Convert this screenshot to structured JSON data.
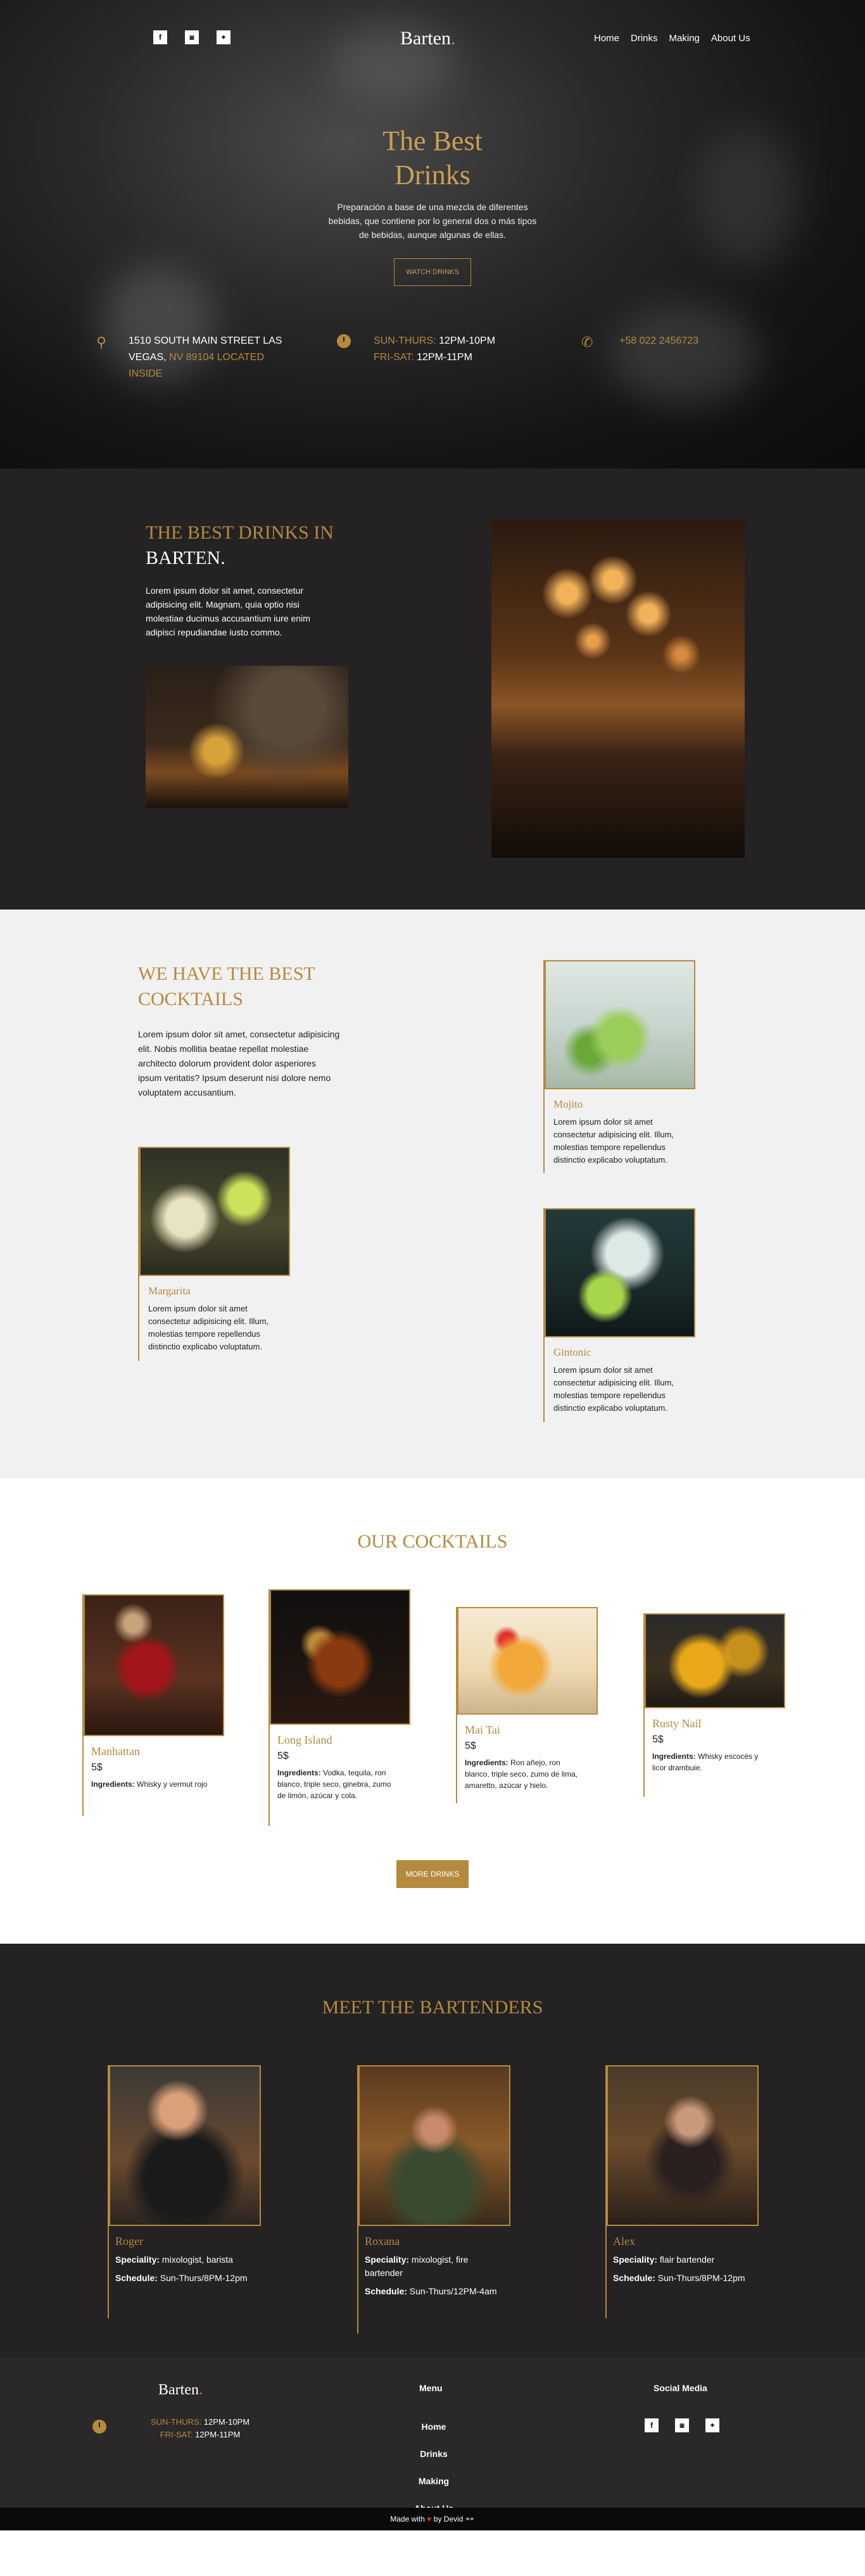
{
  "nav": {
    "brand": "Barten",
    "brand_dot": ".",
    "socials": [
      {
        "icon": "facebook-icon",
        "glyph": "f"
      },
      {
        "icon": "instagram-icon",
        "glyph": "◙"
      },
      {
        "icon": "twitter-icon",
        "glyph": "✦"
      }
    ],
    "menu": [
      "Home",
      "Drinks",
      "Making",
      "About Us"
    ]
  },
  "hero": {
    "title_line1": "The Best",
    "title_line2": "Drinks",
    "text": "Preparación a base de una mezcla de diferentes bebidas, que contiene por lo general dos o más tipos de bebidas, aunque algunas de ellas.",
    "button": "WATCH DRINKS",
    "address_line1": "1510 SOUTH MAIN STREET LAS",
    "address_line2a": "VEGAS,",
    "address_line2b": "NV 89104 LOCATED",
    "address_line3": "INSIDE",
    "hours1_label": "SUN-THURS:",
    "hours1_time": "12PM-10PM",
    "hours2_label": "FRI-SAT:",
    "hours2_time": "12PM-11PM",
    "phone": "+58 022 2456723"
  },
  "about": {
    "title_line1": "THE BEST DRINKS IN",
    "title_line2": "BARTEN",
    "title_dot": ".",
    "text": "Lorem ipsum dolor sit amet, consectetur adipisicing elit. Magnam, quia optio nisi molestiae ducimus accusantium iure enim adipisci repudiandae iusto commo."
  },
  "best": {
    "title": "WE HAVE THE BEST COCKTAILS",
    "text": "Lorem ipsum dolor sit amet, consectetur adipisicing elit. Nobis mollitia beatae repellat molestiae architecto dolorum provident dolor asperiores ipsum veritatis? Ipsum deserunt nisi dolore nemo voluptatem accusantium.",
    "cards": [
      {
        "name": "Mojito",
        "desc": "Lorem ipsum dolor sit amet consectetur adipisicing elit. Illum, molestias tempore repellendus distinctio explicabo voluptatum."
      },
      {
        "name": "Margarita",
        "desc": "Lorem ipsum dolor sit amet consectetur adipisicing elit. Illum, molestias tempore repellendus distinctio explicabo voluptatum."
      },
      {
        "name": "Gintonic",
        "desc": "Lorem ipsum dolor sit amet consectetur adipisicing elit. Illum, molestias tempore repellendus distinctio explicabo voluptatum."
      }
    ]
  },
  "cocktails": {
    "title": "OUR COCKTAILS",
    "items": [
      {
        "name": "Manhattan",
        "price": "5$",
        "ing_label": "Ingredients:",
        "ing": "Whisky y vermut rojo"
      },
      {
        "name": "Long Island",
        "price": "5$",
        "ing_label": "Ingredients:",
        "ing": "Vodka, tequila, ron blanco, triple seco, ginebra, zumo de limón, azúcar y cola."
      },
      {
        "name": "Mai Tai",
        "price": "5$",
        "ing_label": "Ingredients:",
        "ing": "Ron añejo, ron blanco, triple seco, zumo de lima, amaretto, azúcar y hielo."
      },
      {
        "name": "Rusty Nail",
        "price": "5$",
        "ing_label": "Ingredients:",
        "ing": "Whisky escocés y licor drambuie."
      }
    ],
    "button": "MORE DRINKS"
  },
  "bartenders": {
    "title": "MEET THE BARTENDERS",
    "items": [
      {
        "name": "Roger",
        "spec_label": "Speciality:",
        "spec": "mixologist, barista",
        "sched_label": "Schedule:",
        "sched": "Sun-Thurs/8PM-12pm"
      },
      {
        "name": "Roxana",
        "spec_label": "Speciality:",
        "spec": "mixologist, fire bartender",
        "sched_label": "Schedule:",
        "sched": "Sun-Thurs/12PM-4am"
      },
      {
        "name": "Alex",
        "spec_label": "Speciality:",
        "spec": "flair bartender",
        "sched_label": "Schedule:",
        "sched": "Sun-Thurs/8PM-12pm"
      }
    ]
  },
  "footer": {
    "brand": "Barten",
    "brand_dot": ".",
    "hours1_label": "SUN-THURS:",
    "hours1_time": "12PM-10PM",
    "hours2_label": "FRI-SAT:",
    "hours2_time": "12PM-11PM",
    "menu_title": "Menu",
    "menu": [
      "Home",
      "Drinks",
      "Making",
      "About Us"
    ],
    "social_title": "Social Media",
    "made_with": "Made with",
    "by": "by Devid",
    "glasses": "👓"
  },
  "colors": {
    "accent": "#b58a3e",
    "dark": "#242223"
  }
}
